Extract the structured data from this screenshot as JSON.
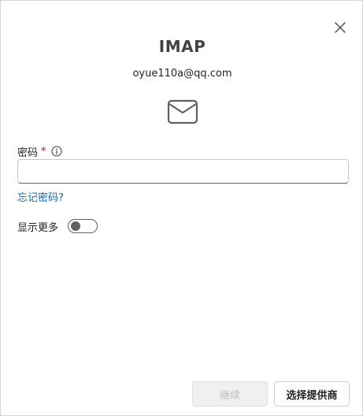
{
  "dialog": {
    "title": "IMAP",
    "email": "oyue110a@qq.com",
    "icons": {
      "close": "close-icon",
      "mail": "mail-icon",
      "info": "info-icon"
    }
  },
  "form": {
    "password_label": "密码",
    "required_mark": "*",
    "password_value": "",
    "forgot_password_link": "忘记密码?",
    "show_more_label": "显示更多",
    "show_more_toggle_on": false
  },
  "footer": {
    "continue_label": "继续",
    "continue_enabled": false,
    "choose_provider_label": "选择提供商"
  },
  "colors": {
    "link": "#0f6cbd",
    "required": "#c50f1f",
    "disabled_bg": "#f0f0f0",
    "disabled_text": "#bdbdbd"
  }
}
